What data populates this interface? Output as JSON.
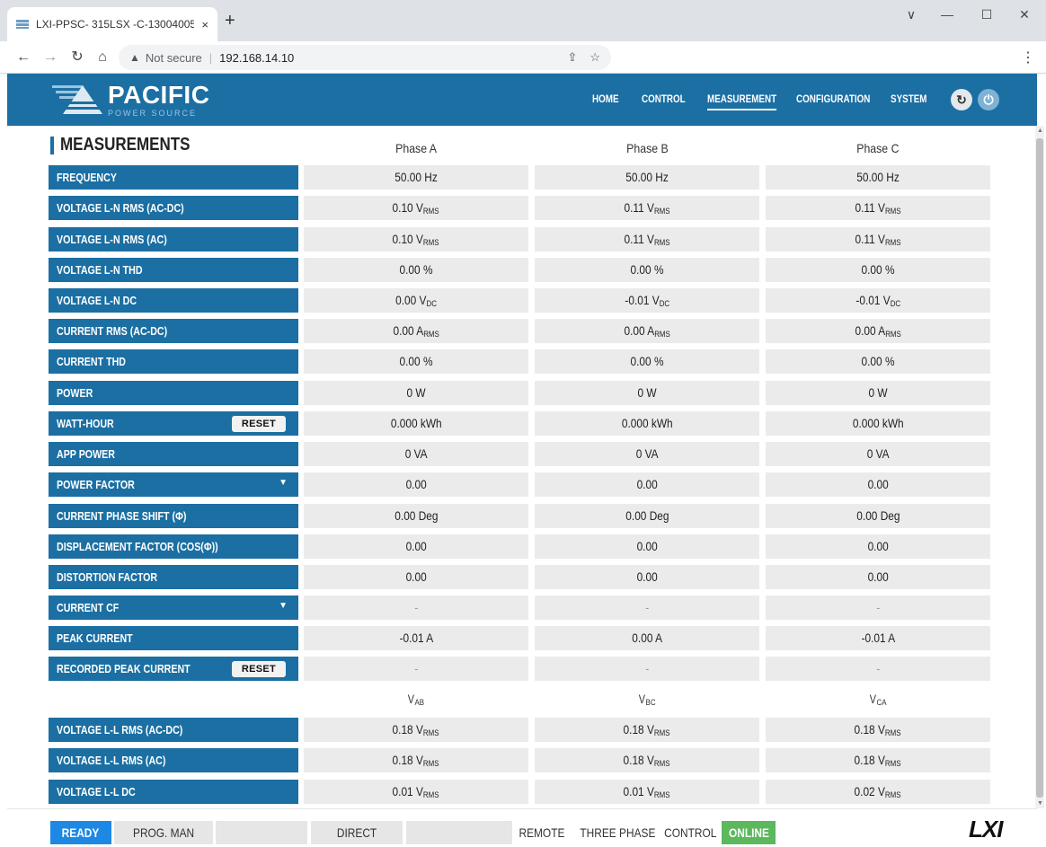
{
  "browser": {
    "tab_title": "LXI-PPSC- 315LSX -C-13004005",
    "tab_close": "×",
    "new_tab": "+",
    "url_warning": "Not secure",
    "url": "192.168.14.10",
    "window_controls": {
      "minimize": "—",
      "maximize": "☐",
      "close": "✕",
      "dropdown": "∨"
    }
  },
  "header": {
    "brand": "PACIFIC",
    "brand_sub": "POWER SOURCE",
    "nav": [
      "HOME",
      "CONTROL",
      "MEASUREMENT",
      "CONFIGURATION",
      "SYSTEM"
    ],
    "active_nav": "MEASUREMENT"
  },
  "measurements": {
    "title": "MEASUREMENTS",
    "phase_headers": [
      "Phase A",
      "Phase B",
      "Phase C"
    ],
    "reset_label": "RESET",
    "rows": [
      {
        "label": "FREQUENCY",
        "values": [
          [
            "50.00 Hz",
            ""
          ],
          [
            "50.00 Hz",
            ""
          ],
          [
            "50.00 Hz",
            ""
          ]
        ]
      },
      {
        "label": "VOLTAGE L-N RMS (AC-DC)",
        "values": [
          [
            "0.10 V",
            "RMS"
          ],
          [
            "0.11 V",
            "RMS"
          ],
          [
            "0.11 V",
            "RMS"
          ]
        ]
      },
      {
        "label": "VOLTAGE L-N RMS (AC)",
        "values": [
          [
            "0.10 V",
            "RMS"
          ],
          [
            "0.11 V",
            "RMS"
          ],
          [
            "0.11 V",
            "RMS"
          ]
        ]
      },
      {
        "label": "VOLTAGE L-N THD",
        "values": [
          [
            "0.00 %",
            ""
          ],
          [
            "0.00 %",
            ""
          ],
          [
            "0.00 %",
            ""
          ]
        ]
      },
      {
        "label": "VOLTAGE L-N DC",
        "values": [
          [
            "0.00 V",
            "DC"
          ],
          [
            "-0.01 V",
            "DC"
          ],
          [
            "-0.01 V",
            "DC"
          ]
        ]
      },
      {
        "label": "CURRENT RMS (AC-DC)",
        "values": [
          [
            "0.00 A",
            "RMS"
          ],
          [
            "0.00 A",
            "RMS"
          ],
          [
            "0.00 A",
            "RMS"
          ]
        ]
      },
      {
        "label": "CURRENT THD",
        "values": [
          [
            "0.00 %",
            ""
          ],
          [
            "0.00 %",
            ""
          ],
          [
            "0.00 %",
            ""
          ]
        ]
      },
      {
        "label": "POWER",
        "values": [
          [
            "0 W",
            ""
          ],
          [
            "0 W",
            ""
          ],
          [
            "0 W",
            ""
          ]
        ]
      },
      {
        "label": "WATT-HOUR",
        "reset": true,
        "values": [
          [
            "0.000 kWh",
            ""
          ],
          [
            "0.000 kWh",
            ""
          ],
          [
            "0.000 kWh",
            ""
          ]
        ]
      },
      {
        "label": "APP POWER",
        "values": [
          [
            "0 VA",
            ""
          ],
          [
            "0 VA",
            ""
          ],
          [
            "0 VA",
            ""
          ]
        ]
      },
      {
        "label": "POWER FACTOR",
        "dropdown": true,
        "values": [
          [
            "0.00",
            ""
          ],
          [
            "0.00",
            ""
          ],
          [
            "0.00",
            ""
          ]
        ]
      },
      {
        "label": "CURRENT PHASE SHIFT (Φ)",
        "values": [
          [
            "0.00 Deg",
            ""
          ],
          [
            "0.00 Deg",
            ""
          ],
          [
            "0.00 Deg",
            ""
          ]
        ]
      },
      {
        "label": "DISPLACEMENT FACTOR (COS(Φ))",
        "values": [
          [
            "0.00",
            ""
          ],
          [
            "0.00",
            ""
          ],
          [
            "0.00",
            ""
          ]
        ]
      },
      {
        "label": "DISTORTION FACTOR",
        "values": [
          [
            "0.00",
            ""
          ],
          [
            "0.00",
            ""
          ],
          [
            "0.00",
            ""
          ]
        ]
      },
      {
        "label": "CURRENT CF",
        "dropdown": true,
        "values": [
          [
            "-",
            ""
          ],
          [
            "-",
            ""
          ],
          [
            "-",
            ""
          ]
        ]
      },
      {
        "label": "PEAK CURRENT",
        "values": [
          [
            "-0.01 A",
            ""
          ],
          [
            "0.00 A",
            ""
          ],
          [
            "-0.01 A",
            ""
          ]
        ]
      },
      {
        "label": "RECORDED PEAK CURRENT",
        "reset": true,
        "values": [
          [
            "-",
            ""
          ],
          [
            "-",
            ""
          ],
          [
            "-",
            ""
          ]
        ]
      }
    ],
    "line_headers": [
      [
        "V",
        "AB"
      ],
      [
        "V",
        "BC"
      ],
      [
        "V",
        "CA"
      ]
    ],
    "line_rows": [
      {
        "label": "VOLTAGE L-L RMS (AC-DC)",
        "values": [
          [
            "0.18 V",
            "RMS"
          ],
          [
            "0.18 V",
            "RMS"
          ],
          [
            "0.18 V",
            "RMS"
          ]
        ]
      },
      {
        "label": "VOLTAGE L-L RMS (AC)",
        "values": [
          [
            "0.18 V",
            "RMS"
          ],
          [
            "0.18 V",
            "RMS"
          ],
          [
            "0.18 V",
            "RMS"
          ]
        ]
      },
      {
        "label": "VOLTAGE L-L DC",
        "values": [
          [
            "0.01 V",
            "RMS"
          ],
          [
            "0.01 V",
            "RMS"
          ],
          [
            "0.02 V",
            "RMS"
          ]
        ]
      }
    ]
  },
  "status": {
    "ready": "READY",
    "prog": "PROG. MAN",
    "direct": "DIRECT",
    "remote": "REMOTE",
    "phase": "THREE PHASE",
    "control": "CONTROL",
    "online": "ONLINE",
    "logo": "LXI"
  },
  "colors": {
    "brand_blue": "#1b6fa3",
    "ready_blue": "#1e88e5",
    "online_green": "#5cb85c",
    "cell_gray": "#ebebeb"
  }
}
